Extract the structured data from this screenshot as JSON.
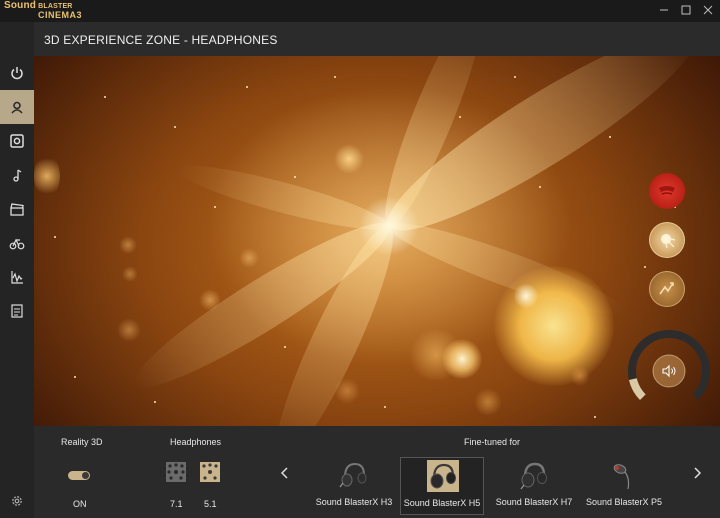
{
  "app": {
    "logo_line1": "Sound",
    "logo_line1_small": "BLASTER",
    "logo_line2": "CINEMA3",
    "window_controls": [
      "minimize-icon",
      "maximize-icon",
      "close-icon"
    ]
  },
  "sidebar": {
    "items": [
      {
        "icon": "power-icon",
        "active": false
      },
      {
        "icon": "surround-3d-icon",
        "active": true
      },
      {
        "icon": "speaker-icon",
        "active": false
      },
      {
        "icon": "music-note-icon",
        "active": false
      },
      {
        "icon": "clapperboard-icon",
        "active": false
      },
      {
        "icon": "bike-icon",
        "active": false
      },
      {
        "icon": "voice-wave-icon",
        "active": false
      },
      {
        "icon": "notepad-icon",
        "active": false
      }
    ],
    "settings_icon": "gear-icon"
  },
  "header": {
    "title": "3D EXPERIENCE ZONE - HEADPHONES"
  },
  "controls": {
    "buttons": [
      {
        "icon": "red-shape-icon",
        "color": "#c8231a"
      },
      {
        "icon": "burst-icon",
        "color": "#d9a24c"
      },
      {
        "icon": "zigzag-icon",
        "color": "#a9793e"
      }
    ],
    "volume": {
      "icon": "volume-icon",
      "level": 0.12
    }
  },
  "bottom": {
    "reality3d": {
      "label": "Reality 3D",
      "state": "ON"
    },
    "headphones": {
      "label": "Headphones",
      "options": [
        "7.1",
        "5.1"
      ],
      "selected": "5.1"
    },
    "finetuned": {
      "label": "Fine-tuned for",
      "items": [
        "Sound BlasterX H3",
        "Sound BlasterX H5",
        "Sound BlasterX H7",
        "Sound BlasterX P5"
      ],
      "selected": "Sound BlasterX H5"
    }
  },
  "colors": {
    "accent": "#b8a88a",
    "brand": "#e9c26a"
  }
}
